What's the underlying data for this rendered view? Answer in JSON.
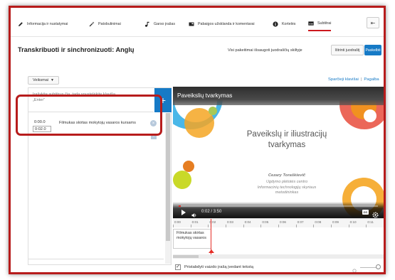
{
  "tabs": [
    {
      "label": "Informacija ir nustatymai",
      "icon": "pencil-icon"
    },
    {
      "label": "Patobulinimai",
      "icon": "magic-wand-icon"
    },
    {
      "label": "Garso įrašas",
      "icon": "music-note-icon"
    },
    {
      "label": "Pabaigos užsklanda ir komentarai",
      "icon": "end-screen-icon"
    },
    {
      "label": "Kortelės",
      "icon": "info-icon"
    },
    {
      "label": "Subtitrai",
      "icon": "subtitles-icon",
      "active": true
    }
  ],
  "header": {
    "title": "Transkribuoti ir sinchronizuoti: Anglų",
    "saved_status": "Visi pakeitimai išsaugoti juodraščių skiltyje",
    "draft_button": "Ištrinti juodraštį",
    "publish_button": "Paskelbti"
  },
  "toolbar": {
    "actions_label": "Veiksmai",
    "shortcuts_link": "Sparčieji klavišai",
    "help_link": "Pagalba"
  },
  "editor": {
    "input_placeholder_line1": "Įrašykite subtitrus čia, tada spustelėkite klavišą",
    "input_placeholder_line2": "„Enter“",
    "add_symbol": "+",
    "cue": {
      "start": "0:00.0",
      "end": "0:02.0",
      "text": "Filmukas skirtas mokytojų vasaros kursams"
    }
  },
  "video": {
    "title": "Paveikslių tvarkymas",
    "slide_title_line1": "Paveikslų ir iliustracijų",
    "slide_title_line2": "tvarkymas",
    "author": "Cezary Toraškievič",
    "org_line1": "Ugdymo plėtotės centro",
    "org_line2": "Informacinių technologijų skyriaus",
    "org_line3": "metodininkas",
    "time": "0:02 / 3:50",
    "progress_fraction": 0.01,
    "cc_label": "CC"
  },
  "timeline": {
    "ticks": [
      "0:00",
      "0:01",
      "0:02",
      "0:03",
      "0:04",
      "0:05",
      "0:06",
      "0:07",
      "0:08",
      "0:09",
      "0:10",
      "0:11"
    ],
    "cue_text": "Filmukas skirtas mokytojų vasaros"
  },
  "footer": {
    "pause_label": "Pristabdyti vaizdo įrašą įvedant tekstą",
    "pause_checked": true
  },
  "colors": {
    "accent_blue": "#167ac6",
    "highlight_red": "#b71c1c",
    "progress_red": "#e52d27"
  }
}
